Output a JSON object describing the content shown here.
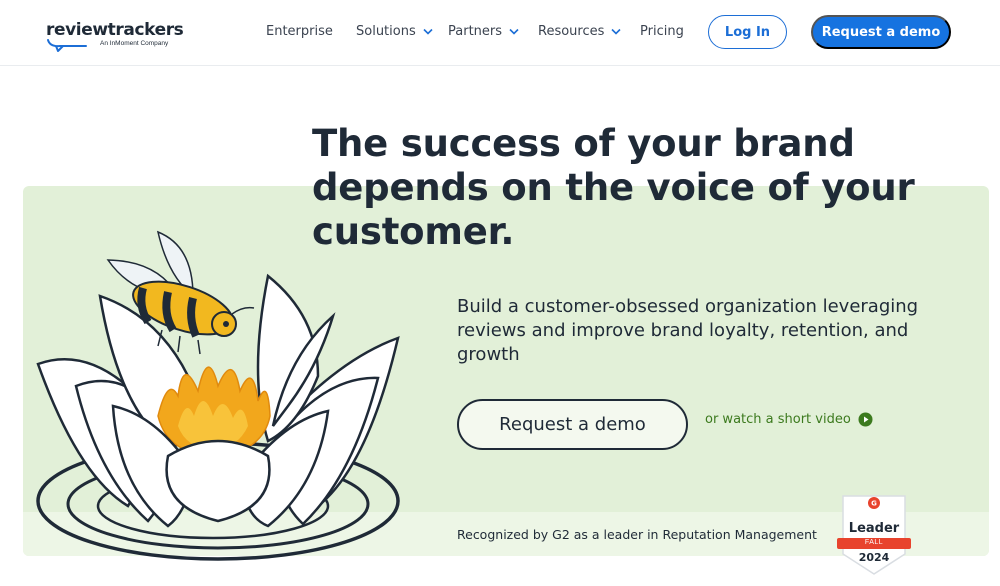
{
  "header": {
    "logo": {
      "name": "reviewtrackers",
      "tagline": "An InMoment Company"
    },
    "nav": [
      {
        "label": "Enterprise",
        "has_dropdown": false
      },
      {
        "label": "Solutions",
        "has_dropdown": true
      },
      {
        "label": "Partners",
        "has_dropdown": true
      },
      {
        "label": "Resources",
        "has_dropdown": true
      },
      {
        "label": "Pricing",
        "has_dropdown": false
      }
    ],
    "login_label": "Log In",
    "demo_label": "Request a demo"
  },
  "hero": {
    "headline": "The success of your brand depends on the voice of your customer.",
    "subhead": "Build a customer-obsessed organization leveraging reviews and improve brand loyalty, retention, and growth",
    "cta_label": "Request a demo",
    "video_label": "or watch a short video",
    "recognition": "Recognized by G2 as a leader in Reputation Management"
  },
  "badge": {
    "title": "Leader",
    "season": "FALL",
    "year": "2024"
  },
  "colors": {
    "accent": "#1673e0",
    "hero_bg": "#e2f0d8",
    "text": "#1f2a37",
    "video_link": "#3c7a1e",
    "badge_red": "#e8432d"
  },
  "icons": [
    "chevron-down-icon",
    "play-icon",
    "g2-icon"
  ]
}
